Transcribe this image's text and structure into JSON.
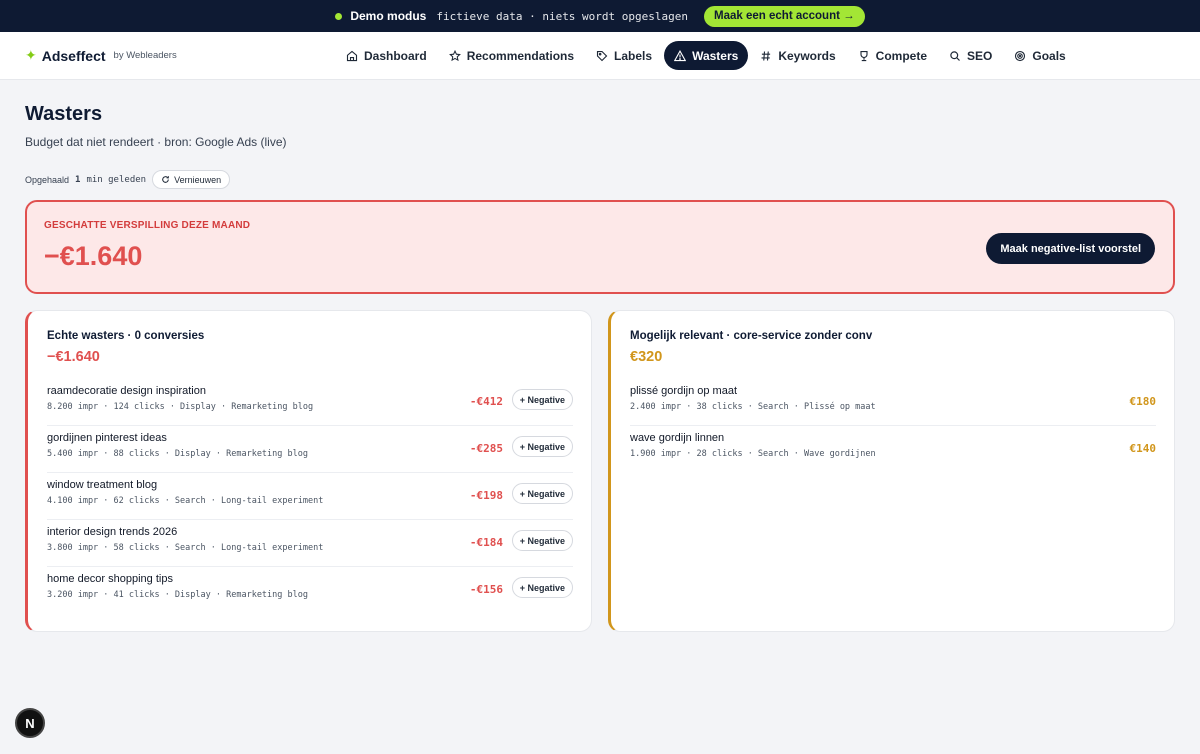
{
  "banner": {
    "title": "Demo modus",
    "note": "fictieve data · niets wordt opgeslagen",
    "cta": "Maak een echt account →"
  },
  "brand": {
    "name": "Adseffect",
    "by": "by Webleaders"
  },
  "nav": [
    {
      "label": "Dashboard",
      "icon": "home-icon"
    },
    {
      "label": "Recommendations",
      "icon": "star-icon"
    },
    {
      "label": "Labels",
      "icon": "tag-icon"
    },
    {
      "label": "Wasters",
      "icon": "warning-icon",
      "active": true
    },
    {
      "label": "Keywords",
      "icon": "hash-icon"
    },
    {
      "label": "Compete",
      "icon": "trophy-icon"
    },
    {
      "label": "SEO",
      "icon": "search-icon"
    },
    {
      "label": "Goals",
      "icon": "target-icon"
    }
  ],
  "page": {
    "title": "Wasters",
    "subtitle": "Budget dat niet rendeert · bron: Google Ads (live)",
    "fetched_prefix": "Opgehaald",
    "fetched_value": "1",
    "fetched_suffix": "min geleden",
    "refresh_label": "Vernieuwen"
  },
  "waste": {
    "label": "GESCHATTE VERSPILLING DEZE MAAND",
    "amount": "−€1.640",
    "button": "Maak negative-list voorstel"
  },
  "wasters": {
    "heading": "Echte wasters · 0 conversies",
    "total": "−€1.640",
    "negative_label": "+ Negative",
    "rows": [
      {
        "keyword": "raamdecoratie design inspiration",
        "meta": "8.200 impr · 124 clicks · Display · Remarketing blog",
        "cost": "-€412"
      },
      {
        "keyword": "gordijnen pinterest ideas",
        "meta": "5.400 impr · 88 clicks · Display · Remarketing blog",
        "cost": "-€285"
      },
      {
        "keyword": "window treatment blog",
        "meta": "4.100 impr · 62 clicks · Search · Long-tail experiment",
        "cost": "-€198"
      },
      {
        "keyword": "interior design trends 2026",
        "meta": "3.800 impr · 58 clicks · Search · Long-tail experiment",
        "cost": "-€184"
      },
      {
        "keyword": "home decor shopping tips",
        "meta": "3.200 impr · 41 clicks · Display · Remarketing blog",
        "cost": "-€156"
      }
    ]
  },
  "relevant": {
    "heading": "Mogelijk relevant · core-service zonder conv",
    "total": "€320",
    "rows": [
      {
        "keyword": "plissé gordijn op maat",
        "meta": "2.400 impr · 38 clicks · Search · Plissé op maat",
        "cost": "€180"
      },
      {
        "keyword": "wave gordijn linnen",
        "meta": "1.900 impr · 28 clicks · Search · Wave gordijnen",
        "cost": "€140"
      }
    ]
  },
  "badge": {
    "letter": "N"
  },
  "colors": {
    "navy": "#0e1a33",
    "lime": "#a3e635",
    "red": "#e0504f",
    "amber": "#d1961c"
  }
}
